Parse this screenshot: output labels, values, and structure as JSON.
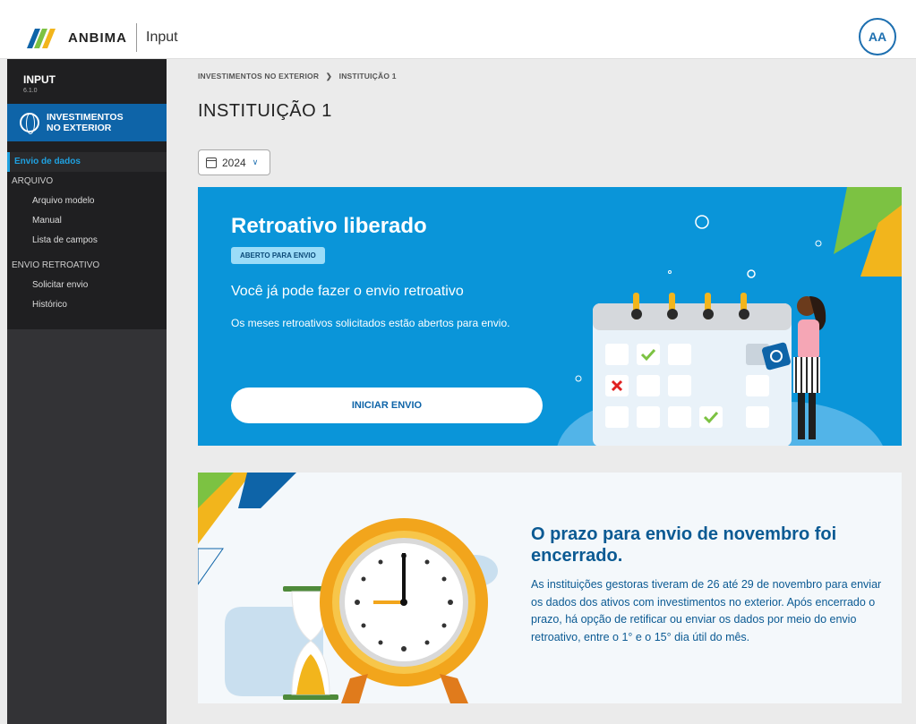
{
  "header": {
    "brand": "ANBIMA",
    "app_name": "Input",
    "user_initials": "AA",
    "colors": {
      "brand_blue": "#0e64a8",
      "brand_green": "#7cc242"
    }
  },
  "sidebar": {
    "app_title": "INPUT",
    "version": "6.1.0",
    "module": "INVESTIMENTOS NO EXTERIOR",
    "items": [
      {
        "label": "Envio de dados",
        "type": "active"
      },
      {
        "label": "ARQUIVO",
        "type": "section"
      },
      {
        "label": "Arquivo modelo",
        "type": "sub"
      },
      {
        "label": "Manual",
        "type": "sub"
      },
      {
        "label": "Lista de campos",
        "type": "sub"
      },
      {
        "label": "ENVIO RETROATIVO",
        "type": "section"
      },
      {
        "label": "Solicitar envio",
        "type": "sub"
      },
      {
        "label": "Histórico",
        "type": "sub"
      }
    ]
  },
  "main": {
    "breadcrumb": [
      "INVESTIMENTOS NO EXTERIOR",
      "INSTITUIÇÃO 1"
    ],
    "title": "INSTITUIÇÃO 1",
    "year": "2024"
  },
  "retro_card": {
    "title": "Retroativo liberado",
    "badge": "ABERTO PARA ENVIO",
    "subtitle": "Você já pode fazer o envio retroativo",
    "description": "Os meses retroativos solicitados estão abertos para envio.",
    "button": "INICIAR ENVIO",
    "background": "#0a95d9"
  },
  "deadline_card": {
    "title": "O prazo para envio de novembro foi encerrado.",
    "text": "As instituições gestoras tiveram de 26 até 29 de novembro para enviar os dados dos ativos com investimentos no exterior. Após encerrado o prazo, há opção de retificar ou enviar os dados por meio do envio retroativo, entre o 1° e o 15° dia útil do mês."
  }
}
